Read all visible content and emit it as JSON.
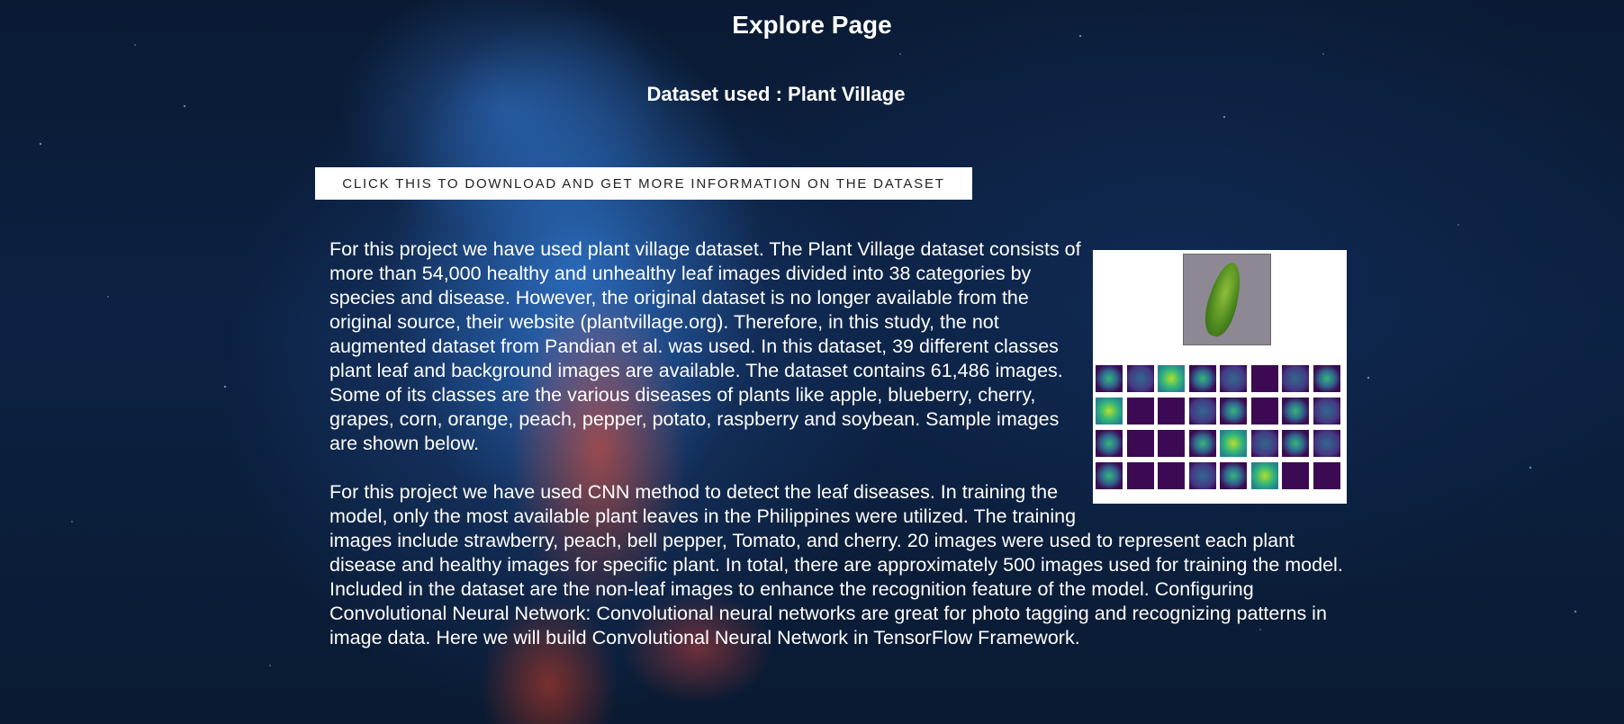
{
  "page": {
    "title": "Explore Page",
    "dataset_heading": "Dataset used : Plant Village",
    "download_button_label": "CLICK THIS TO DOWNLOAD AND GET MORE INFORMATION ON THE DATASET"
  },
  "content": {
    "paragraph_1": "For this project we have used plant village dataset. The Plant Village dataset consists of more than 54,000 healthy and unhealthy leaf images divided into 38 categories by species and disease. However, the original dataset is no longer available from the original source, their website (plantvillage.org). Therefore, in this study, the not augmented dataset from Pandian et al. was used. In this dataset, 39 different classes plant leaf and background images are available. The dataset contains 61,486 images. Some of its classes are the various diseases of plants like apple, blueberry, cherry, grapes, corn, orange, peach, pepper, potato, raspberry and soybean. Sample images are shown below.",
    "paragraph_2": "For this project we have used CNN method to detect the leaf diseases. In training the model, only the most available plant leaves in the Philippines were utilized. The training images include strawberry, peach, bell pepper, Tomato, and cherry. 20 images were used to represent each plant disease and healthy images for specific plant. In total, there are approximately 500 images used for training the model. Included in the dataset are the non-leaf images to enhance the recognition feature of the model. Configuring Convolutional Neural Network: Convolutional neural networks are great for photo tagging and recognizing patterns in image data. Here we will build Convolutional Neural Network in TensorFlow Framework."
  },
  "figure": {
    "filter_cells": [
      "leaf",
      "mid",
      "bright",
      "leaf",
      "mid",
      "",
      "mid",
      "leaf",
      "bright",
      "",
      "",
      "mid",
      "leaf",
      "",
      "leaf",
      "mid",
      "leaf",
      "",
      "",
      "leaf",
      "bright",
      "mid",
      "leaf",
      "mid",
      "leaf",
      "",
      "",
      "mid",
      "leaf",
      "bright",
      "",
      ""
    ]
  },
  "colors": {
    "background_dark": "#0a1a33",
    "text": "#ffffff",
    "button_bg": "#ffffff",
    "button_text": "#222222"
  }
}
